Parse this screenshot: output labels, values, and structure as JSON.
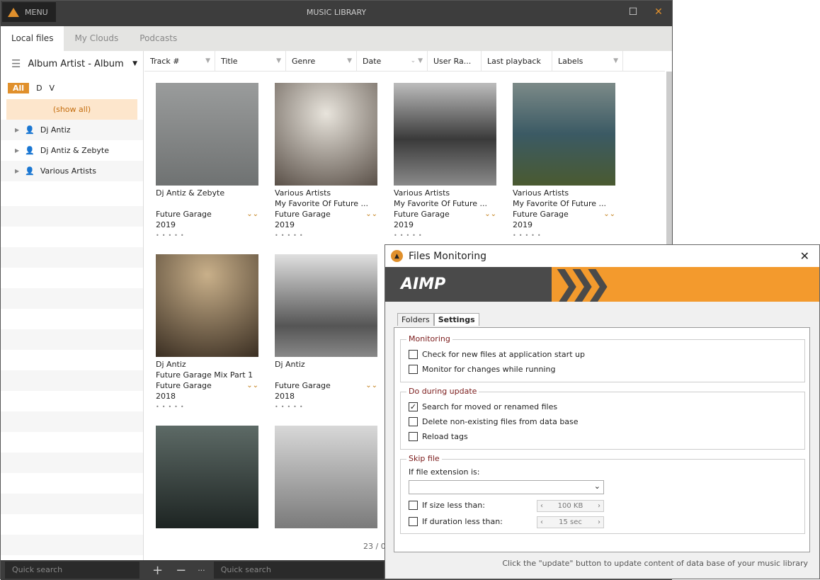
{
  "window": {
    "menu": "MENU",
    "title": "MUSIC LIBRARY",
    "maximize": "☐",
    "close": "✕"
  },
  "tabs": [
    "Local files",
    "My Clouds",
    "Podcasts"
  ],
  "sidebar": {
    "grouping": "Album Artist - Album",
    "letters": [
      "All",
      "D",
      "V"
    ],
    "items": [
      "(show all)",
      "Dj Antiz",
      "Dj Antiz & Zebyte",
      "Various Artists"
    ]
  },
  "columns": [
    "Track #",
    "Title",
    "Genre",
    "Date",
    "User Ra...",
    "Last playback",
    "Labels"
  ],
  "albums": [
    {
      "artist": "Dj Antiz & Zebyte",
      "album": "",
      "genre": "Future Garage",
      "year": "2019",
      "art": "linear-gradient(#9a9c9c,#6f7272)"
    },
    {
      "artist": "Various Artists",
      "album": "My Favorite Of Future ...",
      "genre": "Future Garage",
      "year": "2019",
      "art": "radial-gradient(circle at 50% 30%,#e8e4dc,#5a5048)"
    },
    {
      "artist": "Various Artists",
      "album": "My Favorite Of Future ...",
      "genre": "Future Garage",
      "year": "2019",
      "art": "linear-gradient(#bdbdbd,#3a3a3a 55%,#8a8a8a)"
    },
    {
      "artist": "Various Artists",
      "album": "My Favorite Of Future ...",
      "genre": "Future Garage",
      "year": "2019",
      "art": "linear-gradient(#7c8a88,#3b5a64 50%,#4a5a30)"
    },
    {
      "artist": "Dj Antiz",
      "album": "Future Garage Mix Part 1",
      "genre": "Future Garage",
      "year": "2018",
      "art": "radial-gradient(circle at 50% 20%,#c9b08a,#3a2e22)"
    },
    {
      "artist": "Dj Antiz",
      "album": "",
      "genre": "Future Garage",
      "year": "2018",
      "art": "linear-gradient(#e0e0e0,#555 70%,#888)"
    },
    {
      "artist": "",
      "album": "",
      "genre": "",
      "year": "",
      "art": "linear-gradient(#5d6a66,#1d2422)"
    },
    {
      "artist": "",
      "album": "",
      "genre": "",
      "year": "",
      "art": "linear-gradient(#d8d8d8,#7a7a7a)"
    }
  ],
  "status": "23 / 0",
  "bottom": {
    "quick_search": "Quick search",
    "add": "+",
    "remove": "−",
    "more": "···"
  },
  "dialog": {
    "title": "Files Monitoring",
    "brand": "AIMP",
    "tabs": [
      "Folders",
      "Settings"
    ],
    "monitoring": {
      "legend": "Monitoring",
      "options": [
        {
          "label": "Check for new files at application start up",
          "checked": false
        },
        {
          "label": "Monitor for changes while running",
          "checked": false
        }
      ]
    },
    "update": {
      "legend": "Do during update",
      "options": [
        {
          "label": "Search for moved or renamed files",
          "checked": true
        },
        {
          "label": "Delete non-existing files from data base",
          "checked": false
        },
        {
          "label": "Reload tags",
          "checked": false
        }
      ]
    },
    "skip": {
      "legend": "Skip file",
      "ext_label": "If file extension is:",
      "ext_value": "",
      "size_label": "If size less than:",
      "size_value": "100 KB",
      "duration_label": "If duration less than:",
      "duration_value": "15 sec"
    },
    "footer": "Click the \"update\" button to update content of data base of your music library"
  },
  "colors": {
    "accent": "#e0902c",
    "titlebar": "#3d3d3d",
    "banner": "#f39a2d"
  }
}
